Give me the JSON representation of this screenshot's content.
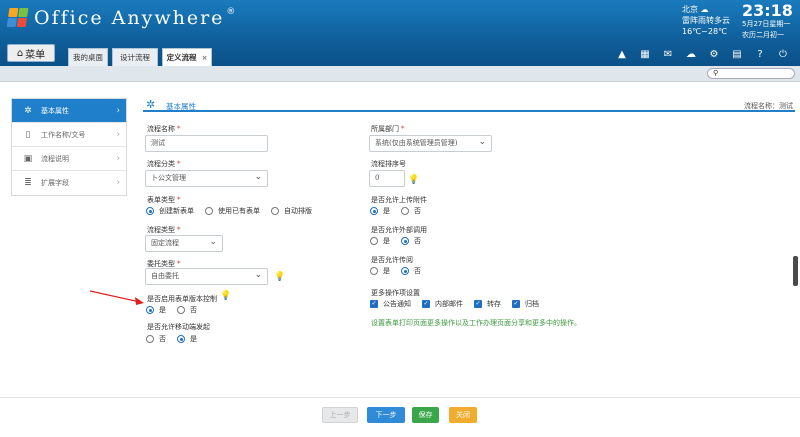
{
  "app": {
    "title": "Office Anywhere",
    "reg": "®"
  },
  "weather": {
    "city": "北京",
    "desc": "雷阵雨转多云",
    "temp": "16℃~28℃"
  },
  "clock": {
    "time": "23:18",
    "date": "5月27日星期一",
    "lunar": "农历二月初一"
  },
  "menu_button": "菜单",
  "tabs": [
    {
      "label": "我的桌面"
    },
    {
      "label": "设计流程"
    },
    {
      "label": "定义流程",
      "close": "×"
    }
  ],
  "sidebar": {
    "items": [
      {
        "label": "基本属性",
        "icon": "gear-icon"
      },
      {
        "label": "工作名称/文号",
        "icon": "document-icon"
      },
      {
        "label": "流程说明",
        "icon": "notes-icon"
      },
      {
        "label": "扩展字段",
        "icon": "list-icon"
      }
    ]
  },
  "section": {
    "title": "基本属性",
    "proc_name": "流程名称：测试"
  },
  "form": {
    "name_label": "流程名称",
    "name_value": "测试",
    "category_label": "流程分类",
    "category_value": "卜公文管理",
    "form_type_label": "表单类型",
    "form_type_opts": [
      "创建新表单",
      "使用已有表单",
      "自动排版"
    ],
    "proc_type_label": "流程类型",
    "proc_type_value": "固定流程",
    "delegate_label": "委托类型",
    "delegate_value": "自由委托",
    "version_label": "是否启用表单版本控制",
    "yes": "是",
    "no": "否",
    "mobile_label": "是否允许移动端发起",
    "dept_label": "所属部门",
    "dept_value": "系统(仅由系统管理员管理)",
    "order_label": "流程排序号",
    "order_value": "0",
    "attach_label": "是否允许上传附件",
    "ext_label": "是否允许外部调用",
    "read_label": "是否允许传阅",
    "more_label": "更多操作项设置",
    "more_opts": [
      "公告通知",
      "内部邮件",
      "转存",
      "归档"
    ],
    "hint": "设置表单打印页面更多操作以及工作办理页面分享和更多中的操作。",
    "required_mark": "*"
  },
  "footer": {
    "prev": "上一步",
    "next": "下一步",
    "save": "保存",
    "close": "关闭"
  },
  "colors": {
    "accent": "#1f7fca",
    "save": "#3aa64a",
    "close": "#f0ac2e"
  }
}
